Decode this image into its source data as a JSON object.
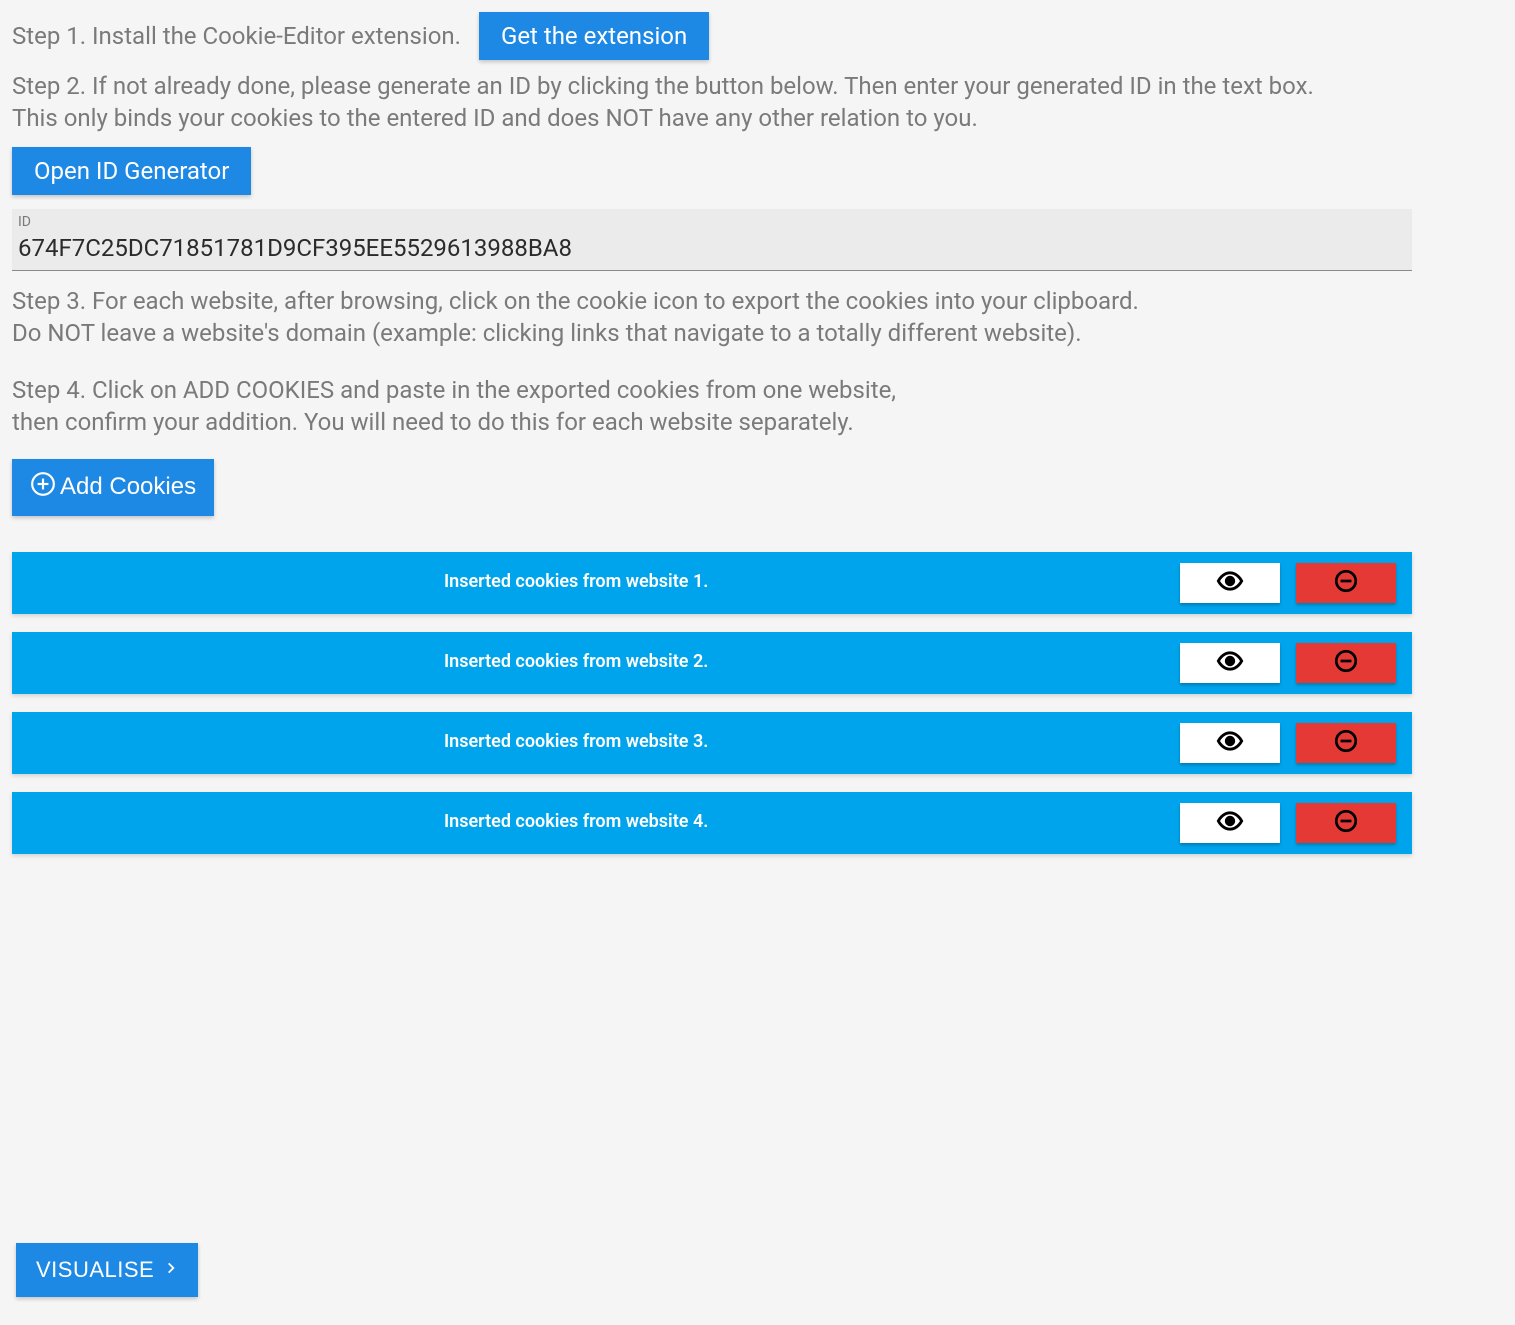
{
  "step1": {
    "text": "Step 1. Install the Cookie-Editor extension.",
    "button": "Get the extension"
  },
  "step2": {
    "text": "Step 2. If not already done, please generate an ID by clicking the button below. Then enter your generated ID in the text box.\nThis only binds your cookies to the entered ID and does NOT have any other relation to you.",
    "button": "Open ID Generator"
  },
  "id_field": {
    "label": "ID",
    "value": "674F7C25DC71851781D9CF395EE5529613988BA8"
  },
  "step3": {
    "text": "Step 3. For each website, after browsing, click on the cookie icon to export the cookies into your clipboard.\nDo NOT leave a website's domain (example: clicking links that navigate to a totally different website)."
  },
  "step4": {
    "text": "Step 4. Click on ADD COOKIES and paste in the exported cookies from one website,\nthen confirm your addition. You will need to do this for each website separately."
  },
  "add_cookies_button": "Add Cookies",
  "cookie_rows": [
    {
      "label": "Inserted cookies from website 1."
    },
    {
      "label": "Inserted cookies from website 2."
    },
    {
      "label": "Inserted cookies from website 3."
    },
    {
      "label": "Inserted cookies from website 4."
    }
  ],
  "visualise_button": "VISUALISE",
  "colors": {
    "primary": "#1e88e5",
    "row": "#00a4ec",
    "danger": "#e53935"
  }
}
